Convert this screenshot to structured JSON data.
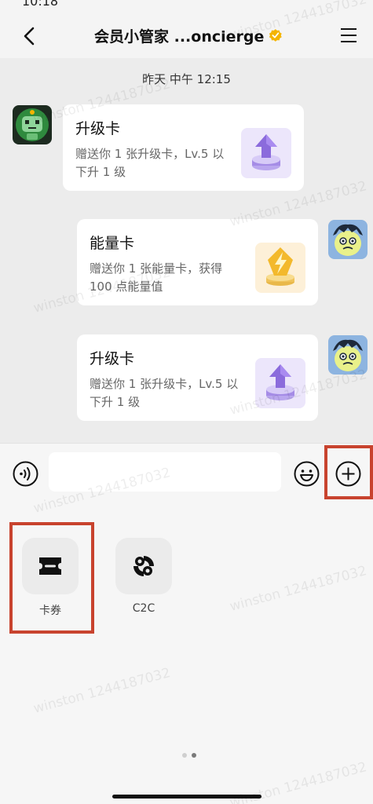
{
  "status_bar": {
    "time": "10:18"
  },
  "header": {
    "title": "会员小管家 ...oncierge",
    "back_icon": "chevron-left-icon",
    "verified_icon": "verified-badge-icon",
    "menu_icon": "hamburger-menu-icon"
  },
  "chat": {
    "timestamp": "昨天 中午 12:15",
    "messages": [
      {
        "side": "left",
        "title": "升级卡",
        "desc": "赠送你 1 张升级卡，Lv.5 以下升 1 级",
        "image": "upgrade-arrow-icon"
      },
      {
        "side": "right",
        "title": "能量卡",
        "desc": "赠送你 1 张能量卡，获得 100 点能量值",
        "image": "energy-bolt-icon"
      },
      {
        "side": "right",
        "title": "升级卡",
        "desc": "赠送你 1 张升级卡，Lv.5 以下升 1 级",
        "image": "upgrade-arrow-icon"
      }
    ]
  },
  "input_bar": {
    "value": "",
    "voice_icon": "voice-icon",
    "emoji_icon": "emoji-icon",
    "plus_icon": "plus-circle-icon"
  },
  "panel": {
    "tools": [
      {
        "label": "卡券",
        "icon": "coupon-ticket-icon"
      },
      {
        "label": "C2C",
        "icon": "c2c-exchange-icon"
      }
    ],
    "page_count": 2,
    "active_page": 2
  },
  "watermark": "winston 1244187032",
  "colors": {
    "highlight": "#c8432e",
    "verified": "#f4b400",
    "chat_bg": "#ececec",
    "panel_bg": "#f6f6f6"
  }
}
